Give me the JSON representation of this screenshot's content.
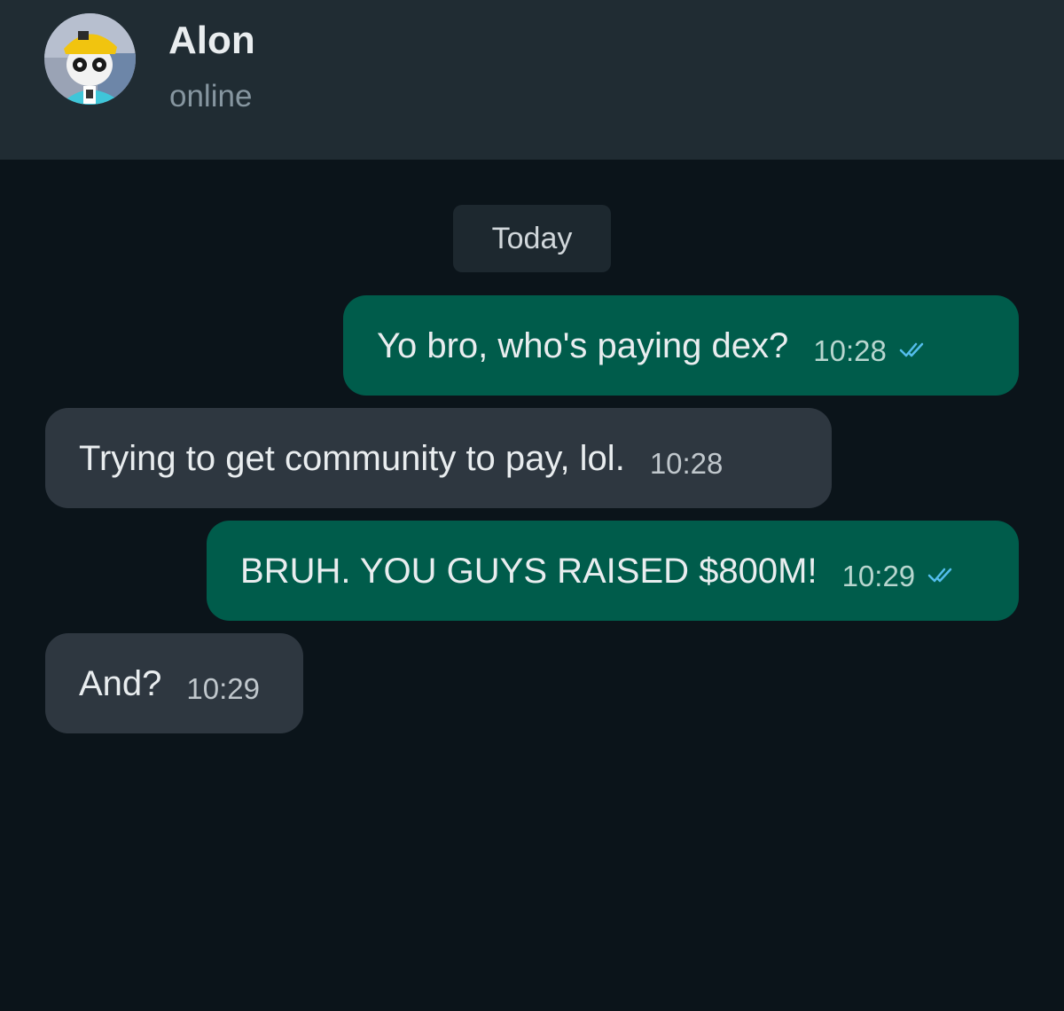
{
  "header": {
    "contact_name": "Alon",
    "status": "online"
  },
  "chat": {
    "date_divider": "Today",
    "messages": [
      {
        "direction": "outgoing",
        "text": "Yo bro, who's paying dex?",
        "time": "10:28",
        "status": "read"
      },
      {
        "direction": "incoming",
        "text": "Trying to get community to pay, lol.",
        "time": "10:28"
      },
      {
        "direction": "outgoing",
        "text": "BRUH. YOU GUYS RAISED $800M!",
        "time": "10:29",
        "status": "read"
      },
      {
        "direction": "incoming",
        "text": "And?",
        "time": "10:29"
      }
    ]
  },
  "colors": {
    "chat_background": "#0b141a",
    "header_background": "#202c33",
    "outgoing_bubble": "#005c4b",
    "incoming_bubble": "#2e3740",
    "read_ticks": "#53bdeb"
  },
  "icons": {
    "avatar": "cartoon-character-avatar",
    "read_receipt": "double-check-icon"
  }
}
